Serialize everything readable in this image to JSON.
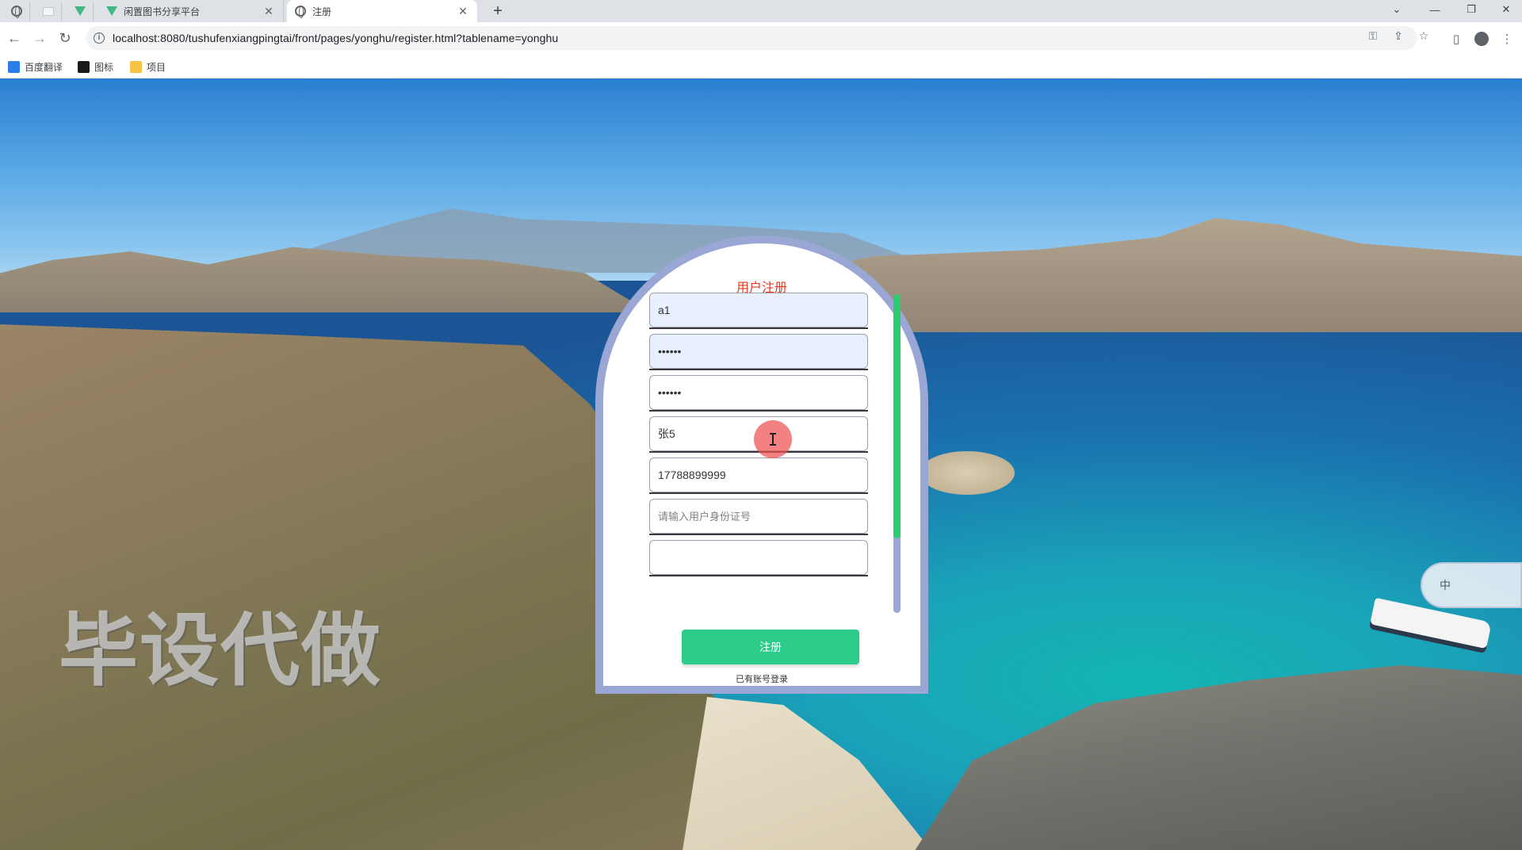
{
  "browser": {
    "tabs": [
      {
        "title": "闲置图书分享平台",
        "icon": "vue-logo-icon",
        "active": false
      },
      {
        "title": "注册",
        "icon": "globe-icon",
        "active": true
      }
    ],
    "tab_close_glyph": "✕",
    "new_tab_glyph": "+",
    "window_controls": {
      "dropdown": "⌄",
      "minimize": "—",
      "restore": "❐",
      "close": "✕"
    },
    "nav": {
      "back": "←",
      "forward": "→",
      "reload": "↻"
    },
    "url": "localhost:8080/tushufenxiangpingtai/front/pages/yonghu/register.html?tablename=yonghu",
    "info_glyph": "i",
    "bookmarks": [
      {
        "label": "百度翻译",
        "icon": "baidu-translate-icon",
        "color": "#2b7de9"
      },
      {
        "label": "图标",
        "icon": "iconfont-icon",
        "color": "#1a1a1a"
      },
      {
        "label": "项目",
        "icon": "folder-icon",
        "color": "#f6c343"
      }
    ]
  },
  "page": {
    "watermark": "毕设代做",
    "ime_label": "中"
  },
  "register": {
    "title": "用户注册",
    "fields": [
      {
        "name": "username",
        "value": "a1",
        "placeholder": "",
        "type": "text",
        "filled": true
      },
      {
        "name": "password",
        "value": "123456",
        "placeholder": "",
        "type": "password",
        "filled": true
      },
      {
        "name": "confirm-password",
        "value": "123456",
        "placeholder": "",
        "type": "password",
        "filled": false
      },
      {
        "name": "fullname",
        "value": "张5",
        "placeholder": "",
        "type": "text",
        "filled": false
      },
      {
        "name": "phone",
        "value": "17788899999",
        "placeholder": "",
        "type": "text",
        "filled": false
      },
      {
        "name": "id-card",
        "value": "",
        "placeholder": "请输入用户身份证号",
        "type": "text",
        "filled": false
      }
    ],
    "submit_label": "注册",
    "login_link": "已有账号登录"
  },
  "colors": {
    "title_red": "#e8351f",
    "button_green": "#2ecc8a",
    "card_border": "#9aa6d4",
    "scroll_thumb": "#2ecc71"
  }
}
